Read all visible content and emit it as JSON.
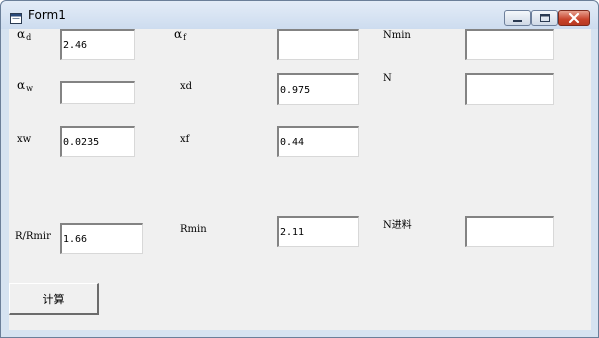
{
  "window": {
    "title": "Form1",
    "icon": "form-window-icon",
    "controls": [
      "minimize-icon",
      "maximize-icon",
      "close-icon"
    ],
    "close_color": "#c8432b"
  },
  "labels": {
    "alpha_d": {
      "greek": "α",
      "sub": "d"
    },
    "alpha_f": {
      "greek": "α",
      "sub": "f"
    },
    "nmin": "Nmin",
    "alpha_w": {
      "greek": "α",
      "sub": "w"
    },
    "xd": "xd",
    "n": "N",
    "xw": "xw",
    "xf": "xf",
    "r_rmin": "R/Rmir",
    "rmin": "Rmin",
    "n_feed": "N进料"
  },
  "fields": {
    "alpha_d": "2.46",
    "alpha_f": "",
    "nmin": "",
    "alpha_w": "",
    "xd": "0.975",
    "n": "",
    "xw": "0.0235",
    "xf": "0.44",
    "r_rmin": "1.66",
    "rmin": "2.11",
    "n_feed": ""
  },
  "buttons": {
    "calculate": "计算"
  }
}
